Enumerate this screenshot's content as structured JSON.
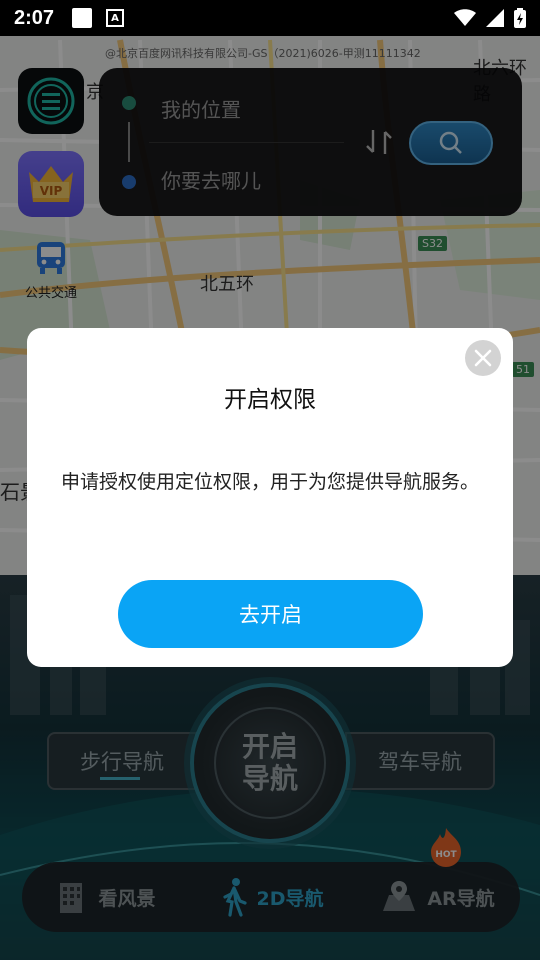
{
  "status_bar": {
    "time": "2:07"
  },
  "map": {
    "copyright": "@北京百度网讯科技有限公司-GS（2021)6026-甲测11111342",
    "labels": {
      "top_right": "北六环路",
      "ring": "北五环",
      "left_edge": "石景",
      "left_top": "京"
    },
    "shields": {
      "s32": "S32",
      "s51": "51"
    }
  },
  "left_tiles": {
    "vip": "VIP",
    "transit_label": "公共交通"
  },
  "route_panel": {
    "from_placeholder": "我的位置",
    "to_placeholder": "你要去哪儿"
  },
  "navigation": {
    "walk_label": "步行导航",
    "drive_label": "驾车导航",
    "start_line1": "开启",
    "start_line2": "导航",
    "hot_badge": "HOT",
    "tabs": [
      {
        "label": "看风景",
        "icon": "building-icon",
        "active": false
      },
      {
        "label": "2D导航",
        "icon": "walker-icon",
        "active": true
      },
      {
        "label": "AR导航",
        "icon": "ar-map-icon",
        "active": false
      }
    ]
  },
  "dialog": {
    "title": "开启权限",
    "message": "申请授权使用定位权限，用于为您提供导航服务。",
    "confirm_label": "去开启"
  },
  "colors": {
    "accent": "#0aa4f5",
    "active_tab": "#2ea3c9",
    "panel_bg": "#0a0a0c",
    "vip_bg": "#6c61f5"
  }
}
